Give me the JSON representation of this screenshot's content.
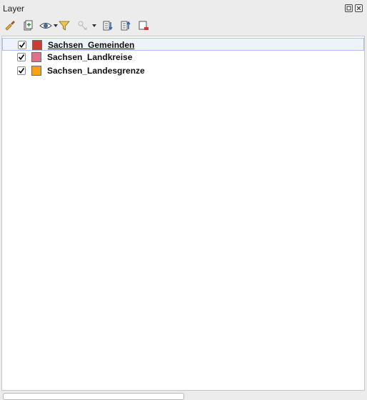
{
  "panel": {
    "title": "Layer",
    "float_icon": "float-icon",
    "close_icon": "close-icon"
  },
  "toolbar": {
    "buttons": [
      {
        "name": "style-brush-icon"
      },
      {
        "name": "add-group-icon"
      },
      {
        "name": "visibility-eye-icon"
      },
      {
        "name": "filter-icon"
      },
      {
        "name": "filter-legend-icon"
      },
      {
        "name": "expand-all-icon"
      },
      {
        "name": "collapse-all-icon"
      },
      {
        "name": "remove-layer-icon"
      }
    ]
  },
  "layers": [
    {
      "name": "Sachsen_Gemeinden",
      "checked": true,
      "color": "#c83c32",
      "selected": true
    },
    {
      "name": "Sachsen_Landkreise",
      "checked": true,
      "color": "#e07088",
      "selected": false
    },
    {
      "name": "Sachsen_Landesgrenze",
      "checked": true,
      "color": "#f8a412",
      "selected": false
    }
  ]
}
